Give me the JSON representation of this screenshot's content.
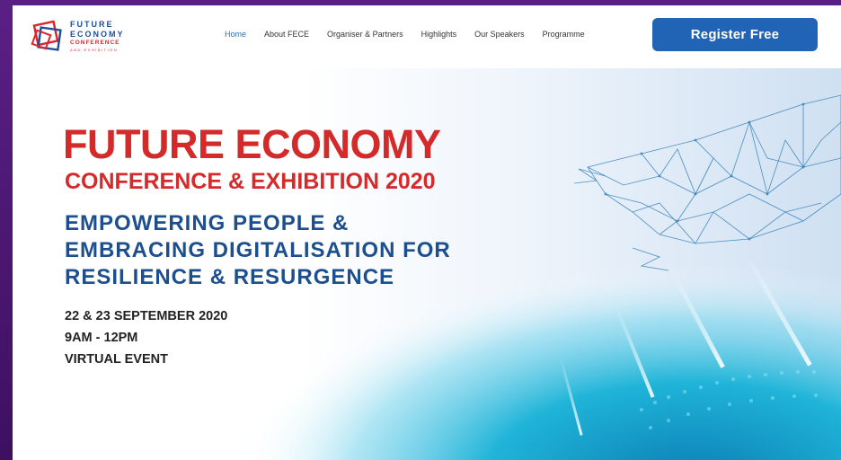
{
  "logo": {
    "line1": "FUTURE",
    "line2": "ECONOMY",
    "line3": "CONFERENCE",
    "line4": "AND EXHIBITION"
  },
  "nav": {
    "items": [
      {
        "label": "Home",
        "active": true
      },
      {
        "label": "About FECE"
      },
      {
        "label": "Organiser & Partners"
      },
      {
        "label": "Highlights"
      },
      {
        "label": "Our Speakers"
      },
      {
        "label": "Programme"
      }
    ],
    "register_label": "Register Free"
  },
  "hero": {
    "title": "FUTURE ECONOMY",
    "subtitle": "CONFERENCE & EXHIBITION 2020",
    "tagline": [
      "EMPOWERING PEOPLE &",
      "EMBRACING DIGITALISATION FOR",
      "RESILIENCE & RESURGENCE"
    ],
    "date": "22 & 23 SEPTEMBER 2020",
    "time": "9AM - 12PM",
    "event_type": "VIRTUAL EVENT"
  },
  "colors": {
    "brand_red": "#d42a2a",
    "brand_blue": "#1d4f8f",
    "button_blue": "#2163b5",
    "frame_purple": "#4a1a6e"
  }
}
